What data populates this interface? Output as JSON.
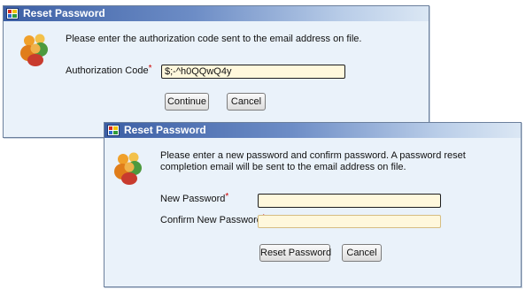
{
  "dialog1": {
    "title": "Reset Password",
    "message": "Please enter the authorization code sent to the email address on file.",
    "auth_code_label": "Authorization Code",
    "required_marker": "*",
    "auth_code_value": "$;-^h0QQwQ4y",
    "continue_label": "Continue",
    "cancel_label": "Cancel",
    "icons": {
      "title": "app-icon",
      "header": "users-icon"
    }
  },
  "dialog2": {
    "title": "Reset Password",
    "message": "Please enter a new password and confirm password. A password reset completion email will be sent to the email address on file.",
    "new_password_label": "New Password",
    "confirm_password_label": "Confirm New Password",
    "required_marker": "*",
    "new_password_value": "",
    "confirm_password_value": "",
    "reset_label": "Reset Password",
    "cancel_label": "Cancel",
    "icons": {
      "title": "app-icon",
      "header": "users-icon"
    }
  },
  "colors": {
    "dialog_background": "#eaf2fa",
    "titlebar_start": "#3c5fa5",
    "titlebar_end": "#dbe7f4",
    "field_background": "#fff8dc",
    "required_marker": "#cc0000"
  }
}
